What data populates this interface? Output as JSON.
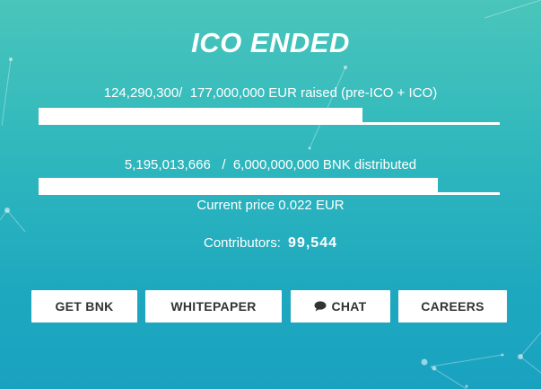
{
  "title": "ICO ENDED",
  "raised": {
    "amount": "124,290,300/",
    "target": "177,000,000 EUR raised (pre-ICO + ICO)",
    "progress_fraction": 0.702
  },
  "distributed": {
    "amount": "5,195,013,666",
    "separator": "/",
    "total": "6,000,000,000 BNK distributed",
    "progress_fraction": 0.866
  },
  "price": {
    "text": "Current price 0.022 EUR"
  },
  "contributors": {
    "label": "Contributors:",
    "count": "99,544"
  },
  "buttons": {
    "get_bnk": "GET BNK",
    "whitepaper": "WHITEPAPER",
    "chat": "CHAT",
    "careers": "CAREERS"
  },
  "icons": {
    "chat": "speech-bubble-icon"
  },
  "colors": {
    "background_top": "#4ac5bb",
    "background_bottom": "#19a2c0",
    "text": "#ffffff",
    "button_bg": "#ffffff",
    "button_text": "#333333"
  }
}
